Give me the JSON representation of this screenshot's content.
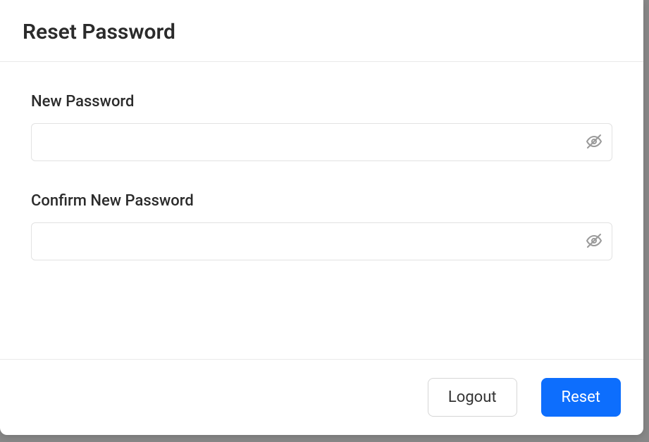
{
  "modal": {
    "title": "Reset Password"
  },
  "form": {
    "new_password": {
      "label": "New Password",
      "value": ""
    },
    "confirm_password": {
      "label": "Confirm New Password",
      "value": ""
    }
  },
  "footer": {
    "logout_label": "Logout",
    "reset_label": "Reset"
  }
}
